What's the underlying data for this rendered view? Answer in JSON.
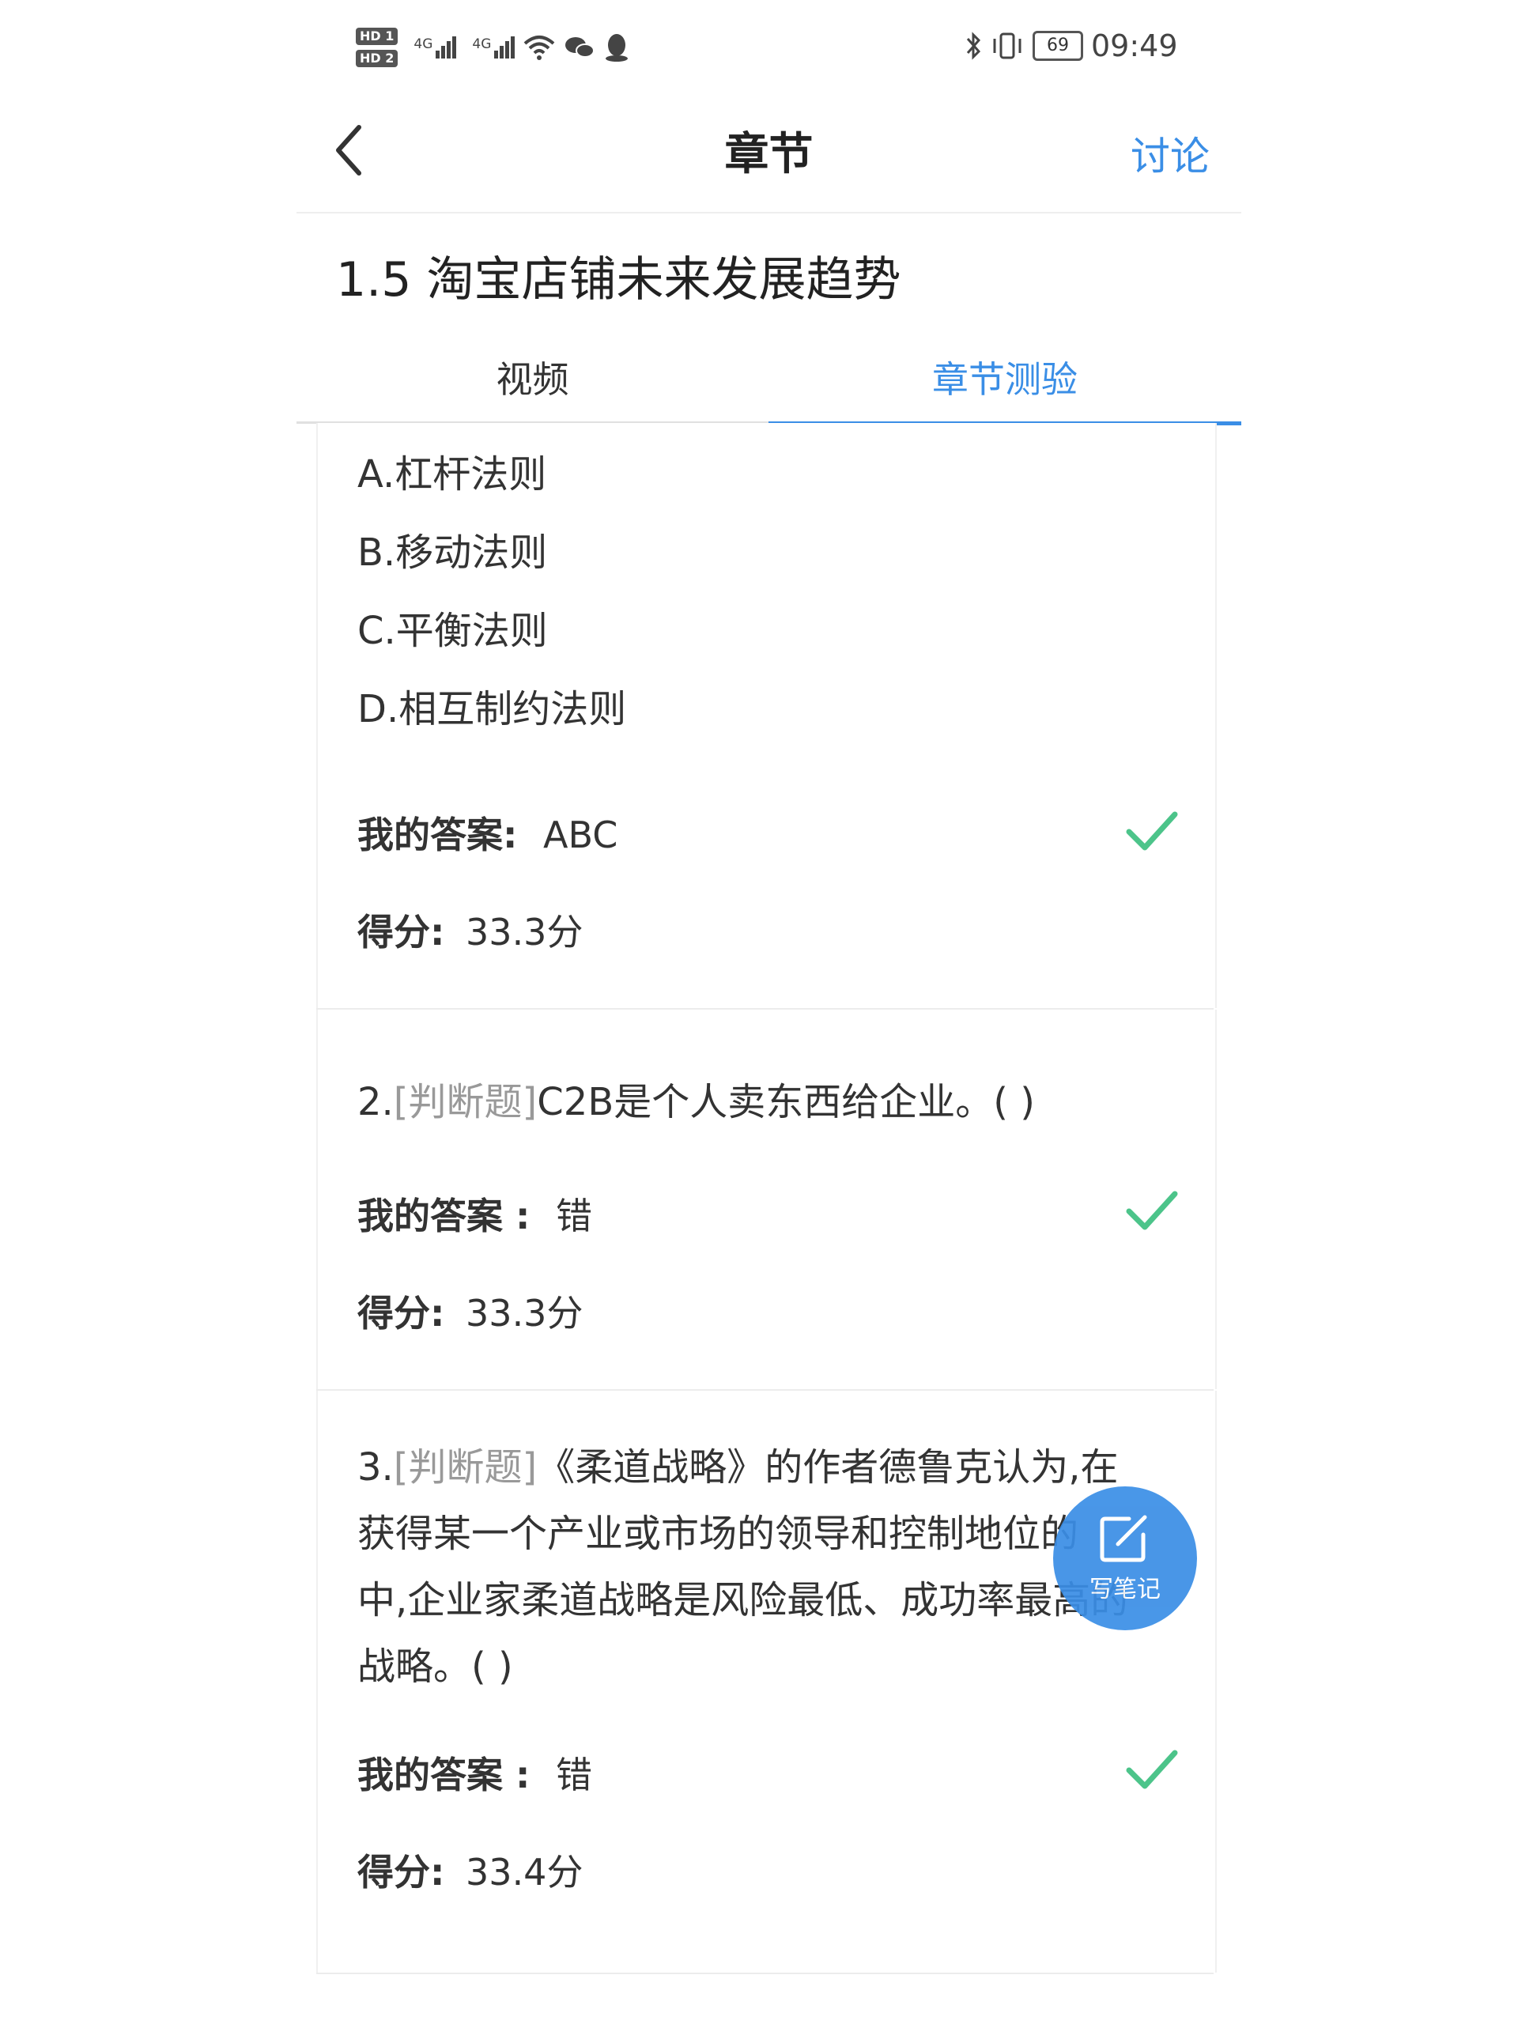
{
  "status_bar": {
    "hd1": "HD 1",
    "hd2": "HD 2",
    "signal1_label": "4G",
    "signal2_label": "4G",
    "battery": "69",
    "time": "09:49",
    "icons": [
      "wifi-icon",
      "wechat-icon",
      "qq-icon",
      "bluetooth-icon",
      "vibrate-icon"
    ]
  },
  "header": {
    "title": "章节",
    "discuss": "讨论"
  },
  "chapter": {
    "title": "1.5 淘宝店铺未来发展趋势"
  },
  "tabs": [
    {
      "label": "视频",
      "active": false
    },
    {
      "label": "章节测验",
      "active": true
    }
  ],
  "questions": [
    {
      "options": [
        "A.杠杆法则",
        "B.移动法则",
        "C.平衡法则",
        "D.相互制约法则"
      ],
      "answer_label": "我的答案:",
      "answer": "ABC",
      "score_label": "得分:",
      "score": "33.3分"
    },
    {
      "number": "2.",
      "type": "[判断题]",
      "text": "C2B是个人卖东西给企业。( )",
      "answer_label": "我的答案 :",
      "answer": "错",
      "score_label": "得分:",
      "score": "33.3分"
    },
    {
      "number": "3.",
      "type": "[判断题]",
      "line1": "《柔道战略》的作者德鲁克认为,在",
      "line2": "获得某一个产业或市场的领导和控制地位的",
      "line3": "中,企业家柔道战略是风险最低、成功率最高的",
      "line4": "战略。( )",
      "answer_label": "我的答案 :",
      "answer": "错",
      "score_label": "得分:",
      "score": "33.4分"
    }
  ],
  "note_button": {
    "label": "写笔记"
  },
  "colors": {
    "accent": "#3a8ee6",
    "check": "#4cc48a"
  }
}
